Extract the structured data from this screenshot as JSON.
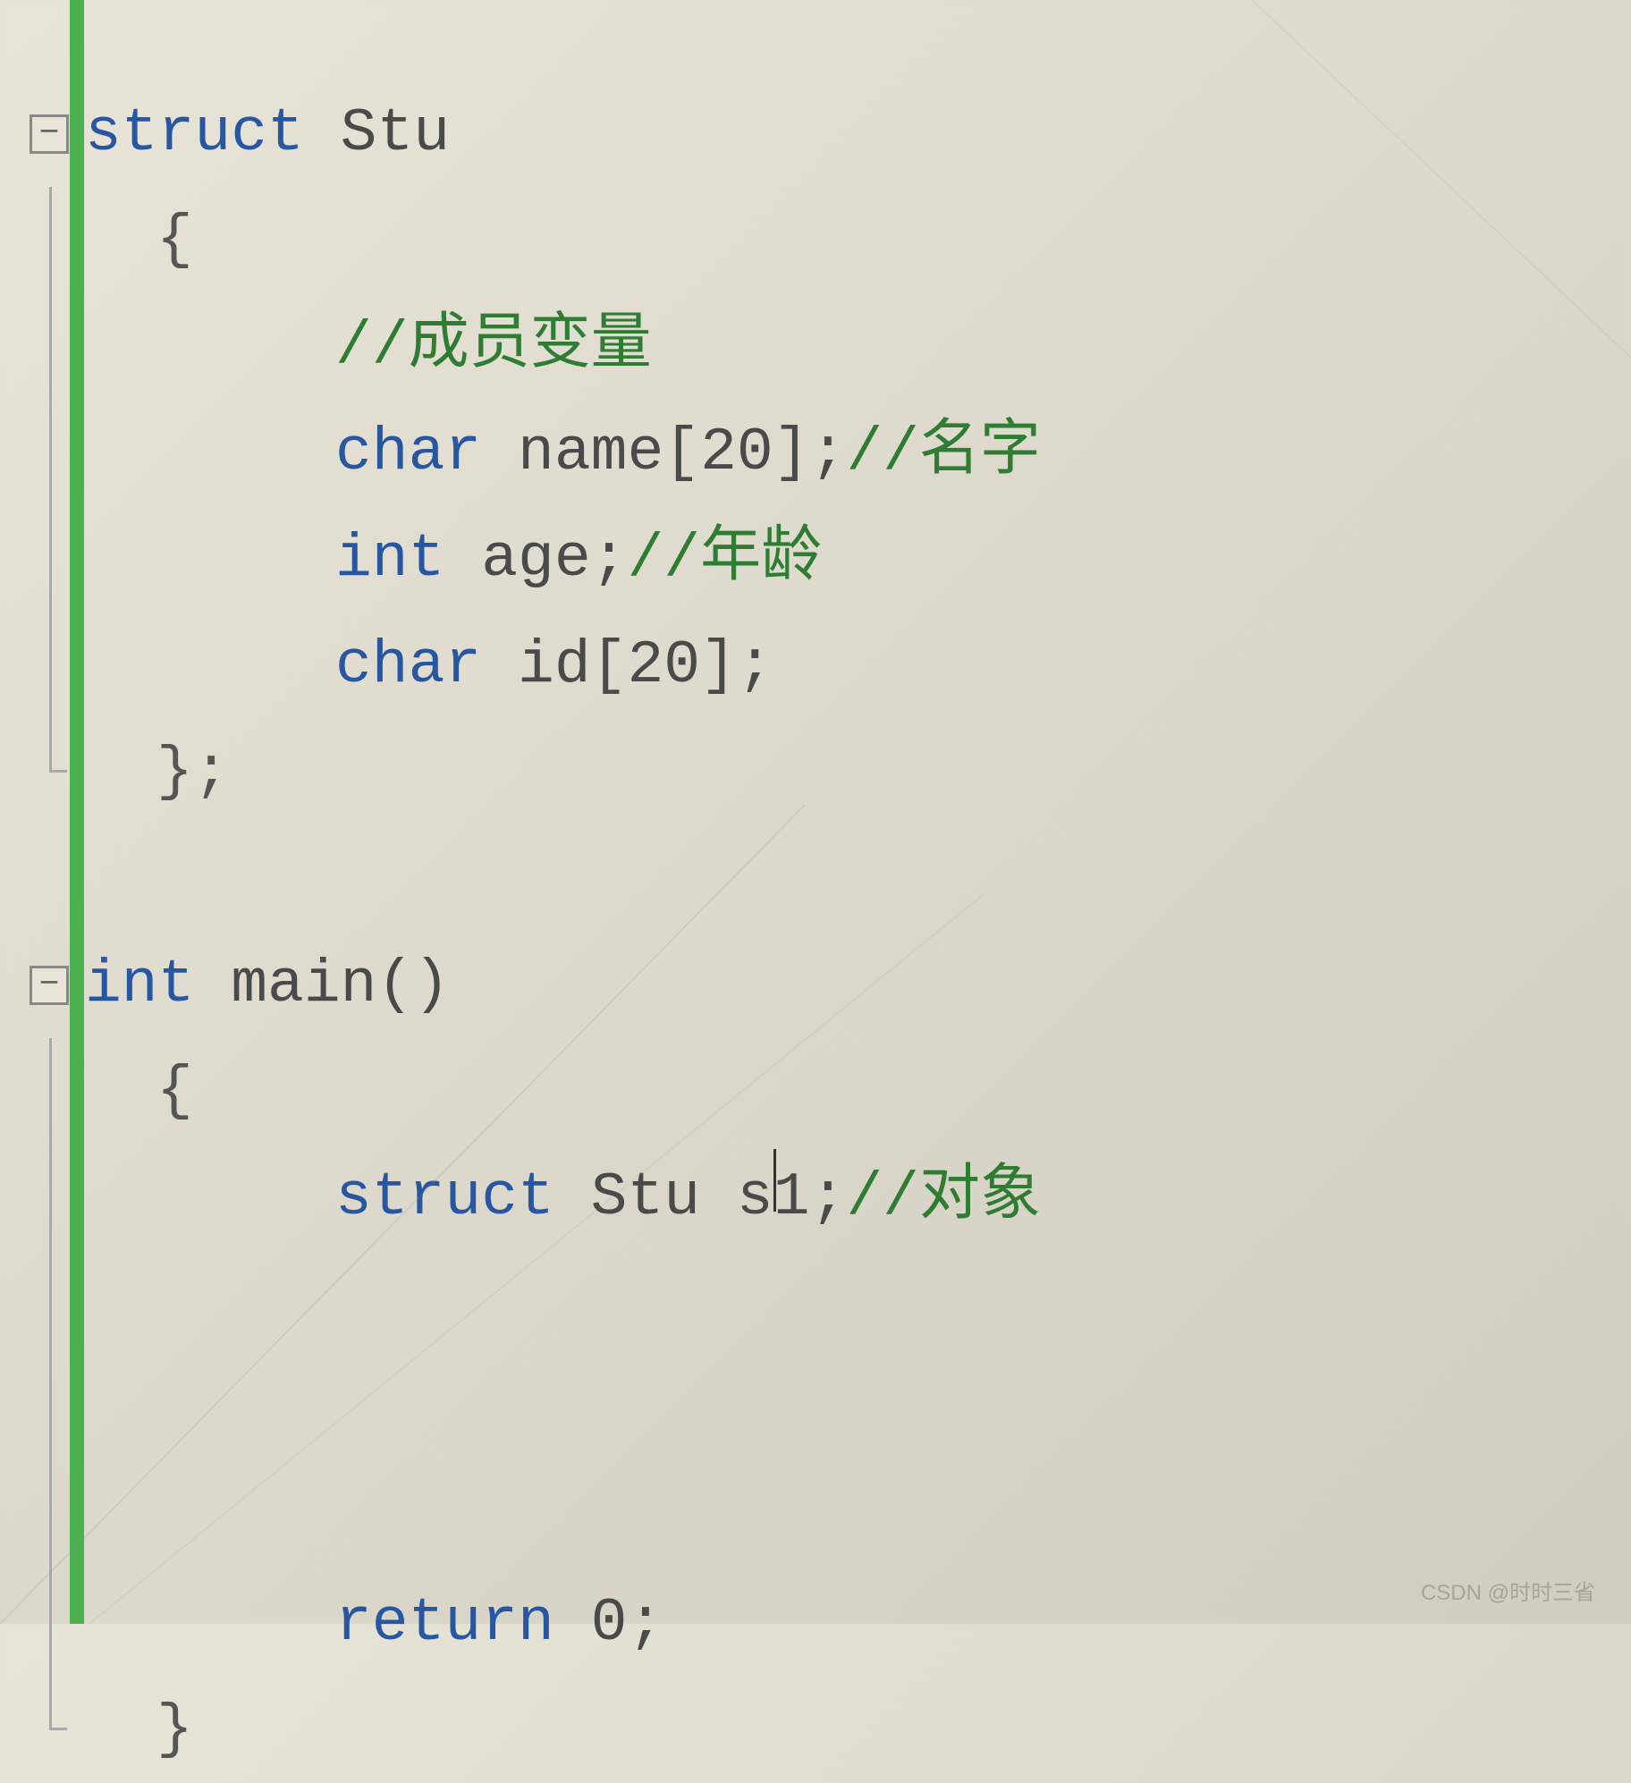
{
  "code": {
    "line1_struct": "struct",
    "line1_name": " Stu",
    "line2_brace": "{",
    "line3_comment": "//成员变量",
    "line4_type": "char",
    "line4_decl": " name[20];",
    "line4_comment": "//名字",
    "line5_type": "int",
    "line5_decl": " age;",
    "line5_comment": "//年龄",
    "line6_type": "char",
    "line6_decl": " id[20];",
    "line7_brace": "};",
    "line9_type": "int",
    "line9_func": " main()",
    "line10_brace": "{",
    "line11_struct": "struct",
    "line11_type": " Stu",
    "line11_var": " s1;",
    "line11_comment": "//对象",
    "line13_return": "return",
    "line13_val": " 0;",
    "line14_brace": "}"
  },
  "fold_markers": {
    "minus": "−"
  },
  "watermark": "CSDN @时时三省"
}
